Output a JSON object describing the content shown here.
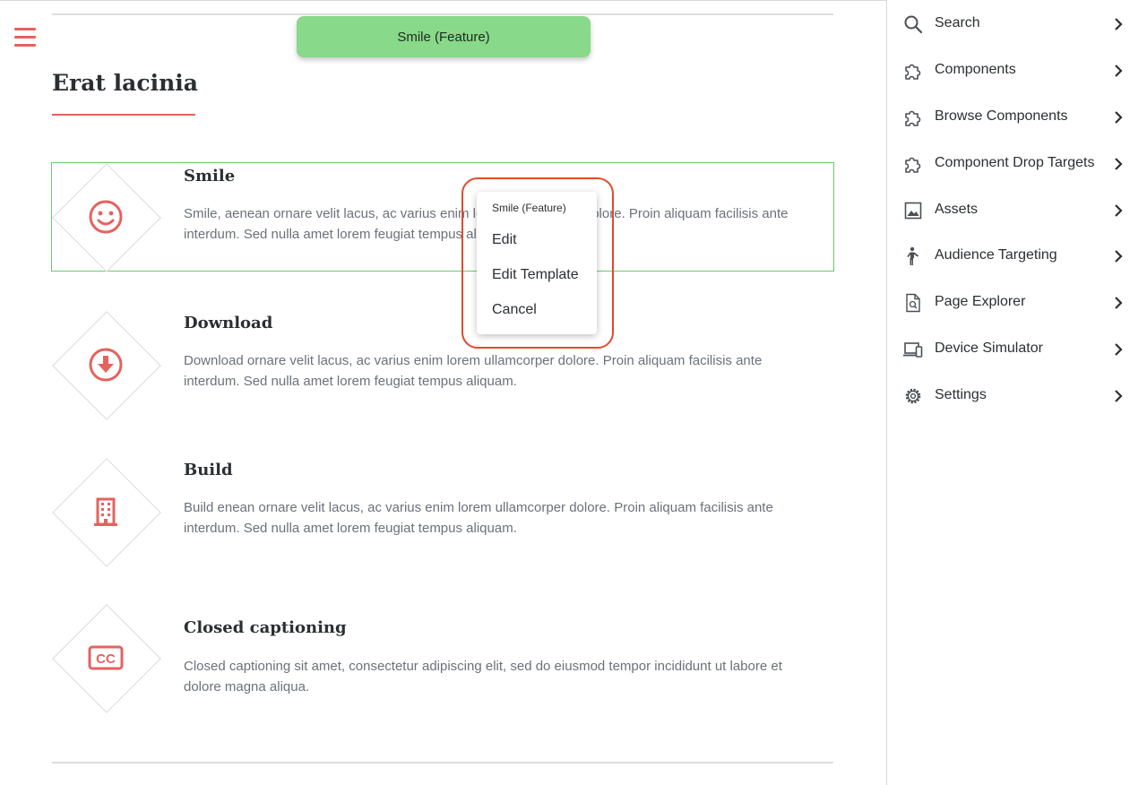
{
  "canvas": {
    "toolbar_chip": "Smile (Feature)",
    "section_title": "Erat lacinia",
    "features": [
      {
        "title": "Smile",
        "text": "Smile, aenean ornare velit lacus, ac varius enim lorem ullamcorper dolore. Proin aliquam facilisis ante interdum. Sed nulla amet lorem feugiat tempus aliquam.",
        "icon": "smile-icon",
        "selected": true
      },
      {
        "title": "Download",
        "text": "Download ornare velit lacus, ac varius enim lorem ullamcorper dolore. Proin aliquam facilisis ante interdum. Sed nulla amet lorem feugiat tempus aliquam.",
        "icon": "download-icon"
      },
      {
        "title": "Build",
        "text": "Build enean ornare velit lacus, ac varius enim lorem ullamcorper dolore. Proin aliquam facilisis ante interdum. Sed nulla amet lorem feugiat tempus aliquam.",
        "icon": "building-icon"
      },
      {
        "title": "Closed captioning",
        "text": "Closed captioning sit amet, consectetur adipiscing elit, sed do eiusmod tempor incididunt ut labore et dolore magna aliqua.",
        "icon": "closed-captioning-icon"
      }
    ]
  },
  "context_menu": {
    "header": "Smile (Feature)",
    "items": [
      "Edit",
      "Edit Template",
      "Cancel"
    ]
  },
  "sidebar": {
    "items": [
      {
        "label": "Search",
        "icon": "search-icon"
      },
      {
        "label": "Components",
        "icon": "puzzle-icon"
      },
      {
        "label": "Browse Components",
        "icon": "puzzle-icon"
      },
      {
        "label": "Component Drop Targets",
        "icon": "puzzle-icon"
      },
      {
        "label": "Assets",
        "icon": "image-icon"
      },
      {
        "label": "Audience Targeting",
        "icon": "person-icon"
      },
      {
        "label": "Page Explorer",
        "icon": "document-search-icon"
      },
      {
        "label": "Device Simulator",
        "icon": "devices-icon"
      },
      {
        "label": "Settings",
        "icon": "gear-icon"
      }
    ]
  },
  "colors": {
    "accent": "#e5625e",
    "chip_background": "#88d98a",
    "selection_outline": "#6cc76f",
    "menu_highlight": "#e24a2e"
  }
}
